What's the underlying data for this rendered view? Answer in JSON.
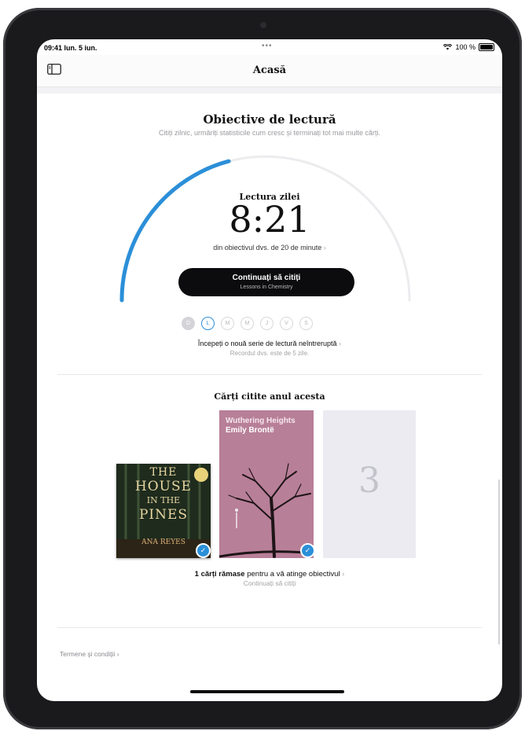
{
  "status": {
    "time": "09:41 lun. 5 iun.",
    "dots": "•••",
    "battery": "100 %"
  },
  "nav": {
    "title": "Acasă"
  },
  "goals": {
    "title": "Obiective de lectură",
    "subtitle": "Citiți zilnic, urmăriți statisticile cum cresc și terminați tot mai multe cărți.",
    "progress_fraction": 0.4175,
    "today_label": "Lectura zilei",
    "today_time": "8:21",
    "goal_text": "din obiectivul dvs. de 20 de minute",
    "chevron": "›",
    "continue_label": "Continuați să citiți",
    "continue_book": "Lessons in Chemistry",
    "days": [
      "D",
      "L",
      "M",
      "M",
      "J",
      "V",
      "S"
    ],
    "streak_text": "Începeți o nouă serie de lectură neîntreruptă",
    "streak_record": "Recordul dvs. este de 5 zile."
  },
  "books": {
    "title": "Cărți citite anul acesta",
    "items": [
      {
        "cover_lines": [
          "THE",
          "HOUSE",
          "IN THE",
          "PINES"
        ],
        "author": "ANA REYES",
        "finished": true
      },
      {
        "title": "Wuthering Heights",
        "author": "Emily Brontë",
        "finished": true
      },
      {
        "placeholder_number": "3"
      }
    ],
    "remaining_bold": "1 cărți rămase",
    "remaining_rest": "pentru a vă atinge obiectivul",
    "remaining_link": "Continuați să citiți"
  },
  "footer": {
    "terms": "Termene și condiții"
  },
  "colors": {
    "accent": "#2b8fd8",
    "button": "#0c0c0e",
    "book2": "#b87f98"
  }
}
